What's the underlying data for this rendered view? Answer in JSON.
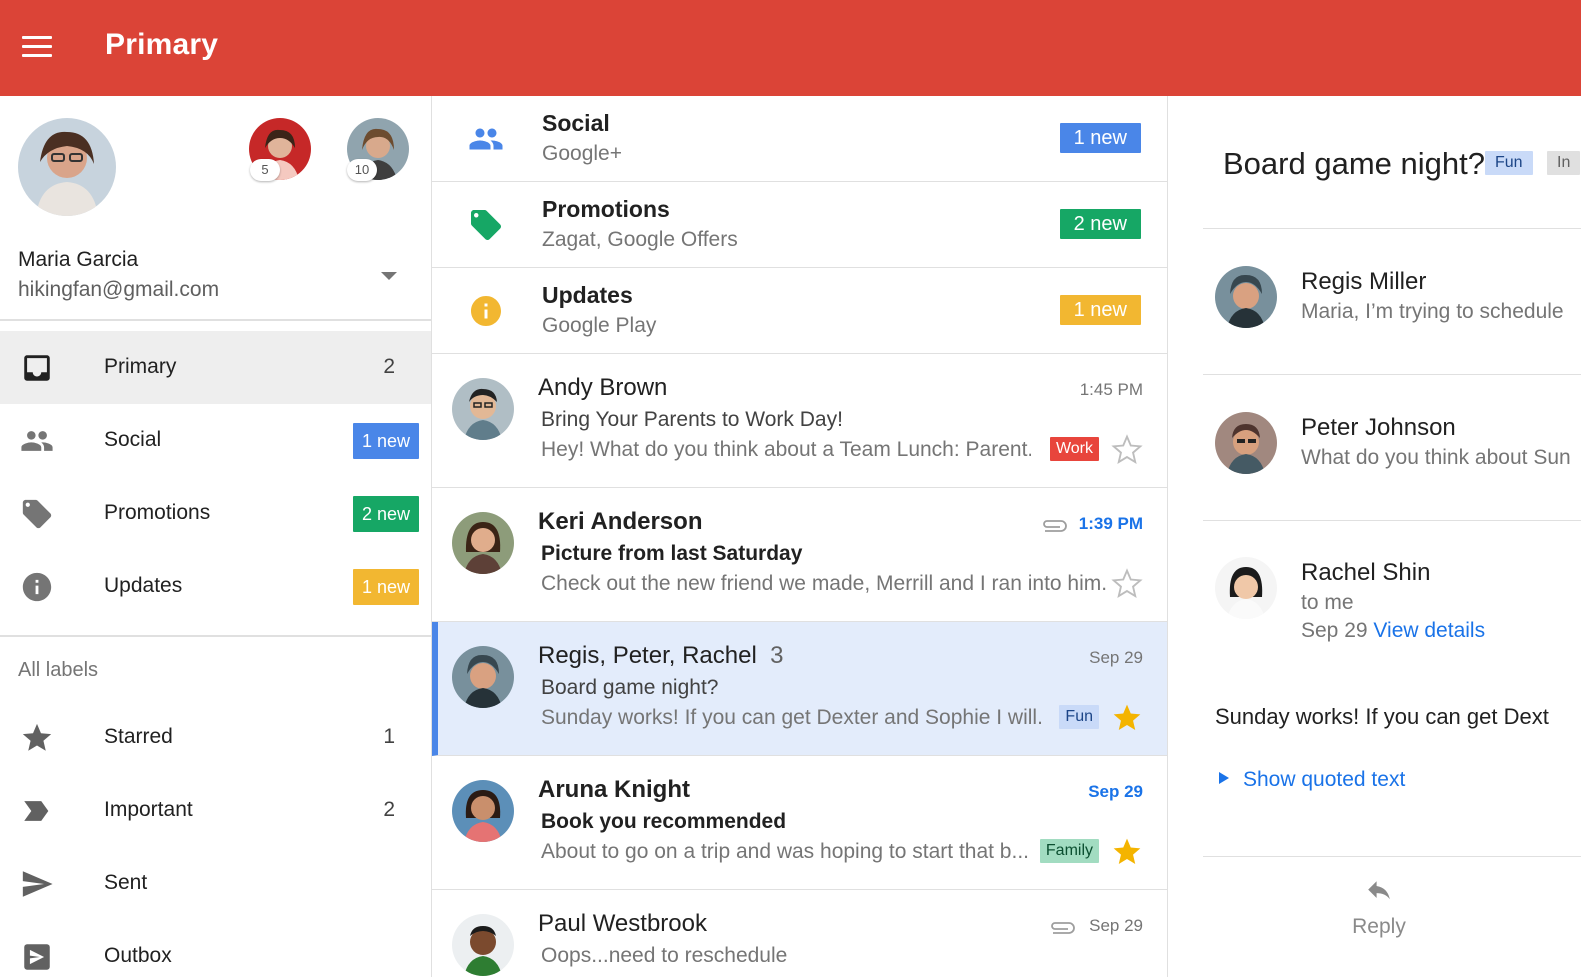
{
  "app_bar": {
    "title": "Primary"
  },
  "account": {
    "name": "Maria Garcia",
    "email": "hikingfan@gmail.com",
    "other_accounts": [
      {
        "badge": "5"
      },
      {
        "badge": "10"
      }
    ]
  },
  "drawer": {
    "items": [
      {
        "label": "Primary",
        "count": "2",
        "icon": "inbox-icon"
      },
      {
        "label": "Social",
        "chip": "1 new",
        "chip_color": "#4a86e8",
        "icon": "people-icon"
      },
      {
        "label": "Promotions",
        "chip": "2 new",
        "chip_color": "#16a765",
        "icon": "tag-icon"
      },
      {
        "label": "Updates",
        "chip": "1 new",
        "chip_color": "#f2b731",
        "icon": "info-icon"
      }
    ],
    "all_labels_title": "All labels",
    "labels": [
      {
        "label": "Starred",
        "count": "1",
        "icon": "star-icon"
      },
      {
        "label": "Important",
        "count": "2",
        "icon": "important-icon"
      },
      {
        "label": "Sent",
        "icon": "send-icon"
      },
      {
        "label": "Outbox",
        "icon": "outbox-icon"
      }
    ]
  },
  "categories": [
    {
      "title": "Social",
      "subtitle": "Google+",
      "chip": "1 new",
      "chip_color": "#4a86e8",
      "icon": "people-icon",
      "icon_color": "#4a86e8"
    },
    {
      "title": "Promotions",
      "subtitle": "Zagat, Google Offers",
      "chip": "2 new",
      "chip_color": "#16a765",
      "icon": "tag-icon",
      "icon_color": "#16a765"
    },
    {
      "title": "Updates",
      "subtitle": "Google Play",
      "chip": "1 new",
      "chip_color": "#f2b731",
      "icon": "info-icon",
      "icon_color": "#f2b731"
    }
  ],
  "emails": [
    {
      "from": "Andy Brown",
      "time": "1:45 PM",
      "subject": "Bring Your Parents to Work Day!",
      "snippet": "Hey! What do you think about a Team Lunch: Parent...",
      "label": "Work",
      "label_bg": "#e8453c",
      "label_fg": "#ffffff",
      "starred": false,
      "unread": false
    },
    {
      "from": "Keri Anderson",
      "time": "1:39 PM",
      "subject": "Picture from last Saturday",
      "snippet": "Check out the new friend we made, Merrill and I ran into him...",
      "attachment": true,
      "starred": false,
      "unread": true
    },
    {
      "from": "Regis, Peter, Rachel",
      "thread_count": "3",
      "time": "Sep 29",
      "subject": "Board game night?",
      "snippet": "Sunday works! If you can get Dexter and Sophie I will...",
      "label": "Fun",
      "label_bg": "#c9daf8",
      "label_fg": "#1c4587",
      "starred": true,
      "unread": false,
      "selected": true
    },
    {
      "from": "Aruna Knight",
      "time": "Sep 29",
      "subject": "Book you recommended",
      "snippet": "About to go on a trip and was hoping to start that b...",
      "label": "Family",
      "label_bg": "#a2dcc1",
      "label_fg": "#0b4f30",
      "starred": true,
      "unread": true
    },
    {
      "from": "Paul Westbrook",
      "time": "Sep 29",
      "subject": "Oops...need to reschedule",
      "attachment": true,
      "starred": false,
      "unread": false
    }
  ],
  "reader": {
    "subject": "Board game night?",
    "labels": [
      {
        "text": "Fun",
        "bg": "#c9daf8",
        "fg": "#1c4587"
      },
      {
        "text": "In",
        "bg": "#e0e0e0",
        "fg": "#616161"
      }
    ],
    "messages": [
      {
        "from": "Regis Miller",
        "preview": "Maria, I’m trying to schedule"
      },
      {
        "from": "Peter Johnson",
        "preview": "What do you think about Sun"
      },
      {
        "from": "Rachel Shin",
        "to": "to me",
        "date": "Sep 29",
        "details_link": "View details"
      }
    ],
    "body": "Sunday works! If you can get Dext",
    "show_quoted": "Show quoted text",
    "reply": "Reply"
  },
  "colors": {
    "accent": "#db4437",
    "link": "#1a73e8",
    "selected_row": "#e3ecfb",
    "star": "#f4b400"
  }
}
